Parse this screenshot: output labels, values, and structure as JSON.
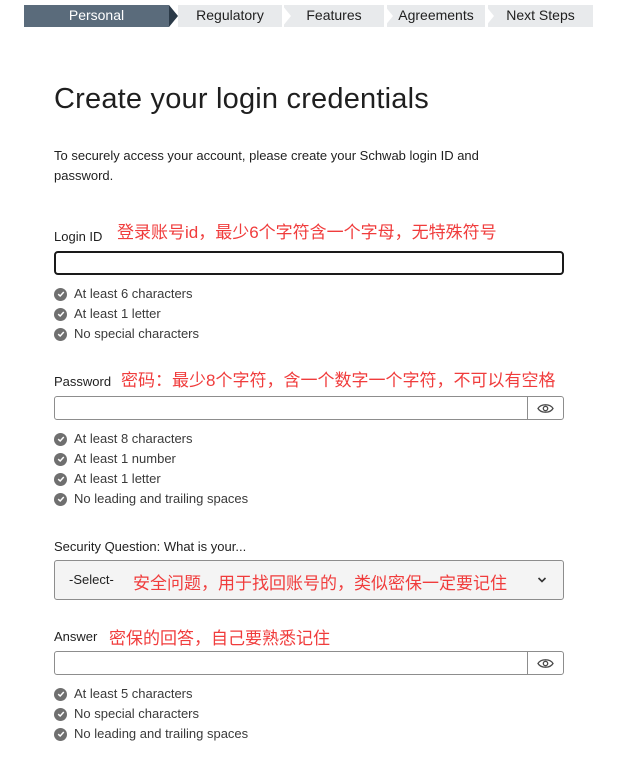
{
  "steps": [
    "Personal",
    "Regulatory",
    "Features",
    "Agreements",
    "Next Steps"
  ],
  "heading": "Create your login credentials",
  "intro": "To securely access your account, please create your Schwab login ID and password.",
  "login": {
    "label": "Login ID",
    "note": "登录账号id，最少6个字符含一个字母，无特殊符号",
    "value": "",
    "rules": [
      "At least 6 characters",
      "At least 1 letter",
      "No special characters"
    ]
  },
  "password": {
    "label": "Password",
    "note": "密码：最少8个字符，含一个数字一个字符，不可以有空格",
    "value": "",
    "toggle_icon": "eye-icon",
    "rules": [
      "At least 8 characters",
      "At least 1 number",
      "At least 1 letter",
      "No leading and trailing spaces"
    ]
  },
  "security_question": {
    "label": "Security Question: What is your...",
    "selected": "-Select-",
    "note": "安全问题，用于找回账号的，类似密保一定要记住"
  },
  "answer": {
    "label": "Answer",
    "note": "密保的回答，自己要熟悉记住",
    "value": "",
    "toggle_icon": "eye-icon",
    "rules": [
      "At least 5 characters",
      "No special characters",
      "No leading and trailing spaces"
    ]
  },
  "colors": {
    "active_step": "#5a6b7b",
    "inactive_step": "#e8eaec",
    "annotation": "#f03c3c",
    "check": "#6f6f6f"
  }
}
